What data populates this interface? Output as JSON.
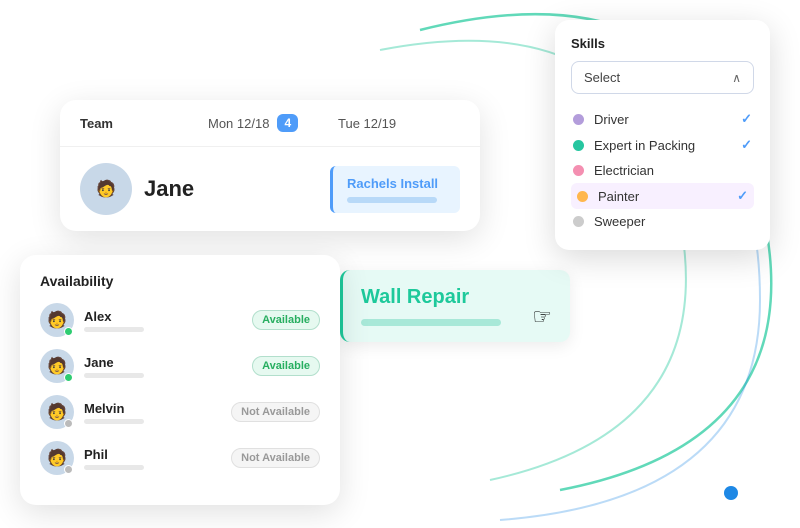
{
  "curves": {
    "color1": "#1ec99b",
    "color2": "#1e88e5"
  },
  "schedule": {
    "header": {
      "team_label": "Team",
      "date1": "Mon 12/18",
      "badge": "4",
      "date2": "Tue 12/19"
    },
    "person": {
      "name": "Jane",
      "avatar_icon": "🧑"
    },
    "task": {
      "label": "Rachels Install"
    }
  },
  "availability": {
    "title": "Availability",
    "people": [
      {
        "name": "Alex",
        "status": "Available",
        "dot": "green"
      },
      {
        "name": "Jane",
        "status": "Available",
        "dot": "green"
      },
      {
        "name": "Melvin",
        "status": "Not Available",
        "dot": "gray"
      },
      {
        "name": "Phil",
        "status": "Not Available",
        "dot": "gray"
      }
    ]
  },
  "wall_repair": {
    "label": "Wall Repair",
    "cursor": "👆"
  },
  "skills": {
    "title": "Skills",
    "select_label": "Select",
    "chevron": "∧",
    "items": [
      {
        "name": "Driver",
        "dot_class": "dot-purple",
        "checked": true
      },
      {
        "name": "Expert in Packing",
        "dot_class": "dot-teal",
        "checked": true
      },
      {
        "name": "Electrician",
        "dot_class": "dot-pink",
        "checked": false
      },
      {
        "name": "Painter",
        "dot_class": "dot-orange",
        "checked": true
      },
      {
        "name": "Sweeper",
        "dot_class": "dot-lightgray",
        "checked": false
      }
    ]
  }
}
